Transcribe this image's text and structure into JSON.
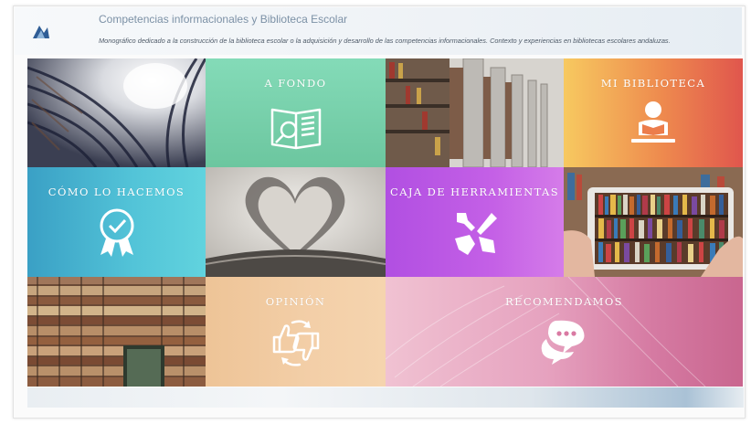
{
  "header": {
    "logo_text": "",
    "title": "Competencias informacionales y Biblioteca Escolar",
    "subtitle": "Monográfico dedicado a la construcción de la biblioteca escolar o la adquisición y desarrollo de las competencias informacionales. Contexto y experiencias en bibliotecas escolares andaluzas."
  },
  "tiles": {
    "a_fondo": {
      "label": "A FONDO",
      "color_top": "#7fd6b2",
      "color_bottom": "#6ec59c"
    },
    "mi_biblioteca": {
      "label": "MI BIBLIOTECA",
      "color_left": "#f6c25f",
      "color_right": "#e05a4a"
    },
    "como_lo_hacemos": {
      "label": "CÓMO LO HACEMOS",
      "color_left": "#3fa3c6",
      "color_right": "#5fd1de"
    },
    "caja_de_herramientas": {
      "label": "CAJA DE HERRAMIENTAS",
      "color_left": "#b44fe3",
      "color_right": "#d87ce8"
    },
    "opinion": {
      "label": "OPINIÓN",
      "color_left": "#efc89e",
      "color_right": "#f6d2ac"
    },
    "recomendamos": {
      "label": "RECOMENDAMOS",
      "color_left": "#e8a2c2",
      "color_right": "#ce6f9a"
    }
  },
  "photos": [
    "library-rotunda-photo",
    "library-stacks-photo",
    "heart-book-pages-photo",
    "tablet-bookshelf-photo",
    "stacked-books-photo"
  ]
}
